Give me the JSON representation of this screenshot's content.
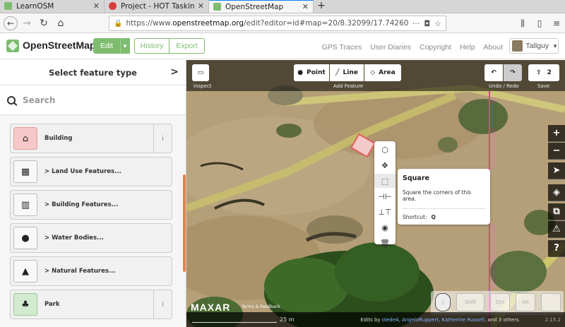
{
  "browser": {
    "tabs": [
      {
        "title": "LearnOSM",
        "color": "#7ebc6f",
        "active": false
      },
      {
        "title": "Project - HOT Tasking Ma",
        "color": "#d73f3f",
        "active": false
      },
      {
        "title": "OpenStreetMap",
        "color": "#7ebc6f",
        "active": true
      }
    ],
    "new_tab": "+",
    "url_prefix": "https://www.",
    "url_host": "openstreetmap.org",
    "url_rest": "/edit?editor=id#map=20/8.32099/17.74260",
    "url_menu": "···"
  },
  "osm": {
    "brand": "OpenStreetMap",
    "edit": "Edit",
    "history": "History",
    "export": "Export",
    "links": [
      "GPS Traces",
      "User Diaries",
      "Copyright",
      "Help",
      "About"
    ],
    "user": "Tallguy"
  },
  "sidebar": {
    "title": "Select feature type",
    "search_placeholder": "Search",
    "items": [
      {
        "label": "Building",
        "icon": "building-icon",
        "glyph": "⌂",
        "kind": "building",
        "info": "i"
      },
      {
        "label": "> Land Use Features...",
        "icon": "landuse-icon",
        "glyph": "▦",
        "kind": "cat"
      },
      {
        "label": "> Building Features...",
        "icon": "building-features-icon",
        "glyph": "▥",
        "kind": "cat"
      },
      {
        "label": "> Water Bodies...",
        "icon": "water-icon",
        "glyph": "●",
        "kind": "cat"
      },
      {
        "label": "> Natural Features...",
        "icon": "natural-icon",
        "glyph": "▲",
        "kind": "cat"
      },
      {
        "label": "Park",
        "icon": "park-icon",
        "glyph": "♣",
        "kind": "park",
        "info": "i"
      }
    ]
  },
  "map": {
    "inspect": "Inspect",
    "add_feature": "Add Feature",
    "point": "Point",
    "line": "Line",
    "area": "Area",
    "undo_redo": "Undo / Redo",
    "save": "Save",
    "save_count": "2",
    "tooltip": {
      "title": "Square",
      "desc": "Square the corners of this area.",
      "shortcut_label": "Shortcut:",
      "shortcut_key": "Q"
    },
    "imagery": "MAXAR",
    "terms": "Terms & Feedback",
    "scale": "25 m",
    "edits_prefix": "Edits by ",
    "editors": "olede4, AngelaRuppert, Katherine Russell",
    "edits_suffix": ", and 3 others",
    "version": "2.15.2",
    "keys": [
      "Shift",
      "Ctrl",
      "Alt"
    ]
  }
}
